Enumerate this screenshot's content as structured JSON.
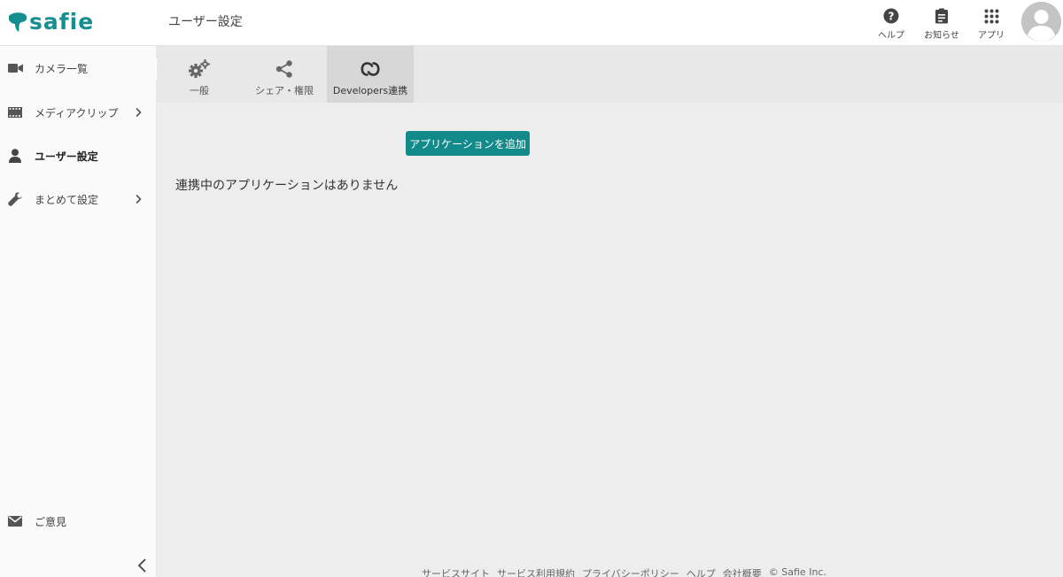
{
  "header": {
    "logo_text": "safie",
    "page_title": "ユーザー設定",
    "actions": [
      {
        "label": "ヘルプ",
        "icon": "help-circle-icon"
      },
      {
        "label": "お知らせ",
        "icon": "clipboard-icon"
      },
      {
        "label": "アプリ",
        "icon": "apps-grid-icon"
      }
    ],
    "brand_color": "#138f8f"
  },
  "sidebar": {
    "items": [
      {
        "label": "カメラ一覧",
        "icon": "video-camera-icon"
      },
      {
        "label": "メディアクリップ",
        "icon": "film-icon"
      },
      {
        "label": "ユーザー設定",
        "icon": "user-icon"
      },
      {
        "label": "まとめて設定",
        "icon": "wrench-icon"
      }
    ],
    "feedback_label": "ご意見",
    "feedback_icon": "envelope-icon"
  },
  "tabs": [
    {
      "label": "一般",
      "icon": "gears-icon"
    },
    {
      "label": "シェア・権限",
      "icon": "share-icon"
    },
    {
      "label": "Developers連携",
      "icon": "link-icon"
    }
  ],
  "main": {
    "add_button_label": "アプリケーションを追加",
    "empty_message": "連携中のアプリケーションはありません",
    "button_color": "#138a8a"
  },
  "footer": {
    "links": [
      "サービスサイト",
      "サービス利用規約",
      "プライバシーポリシー",
      "ヘルプ",
      "会社概要",
      "© Safie Inc."
    ]
  }
}
